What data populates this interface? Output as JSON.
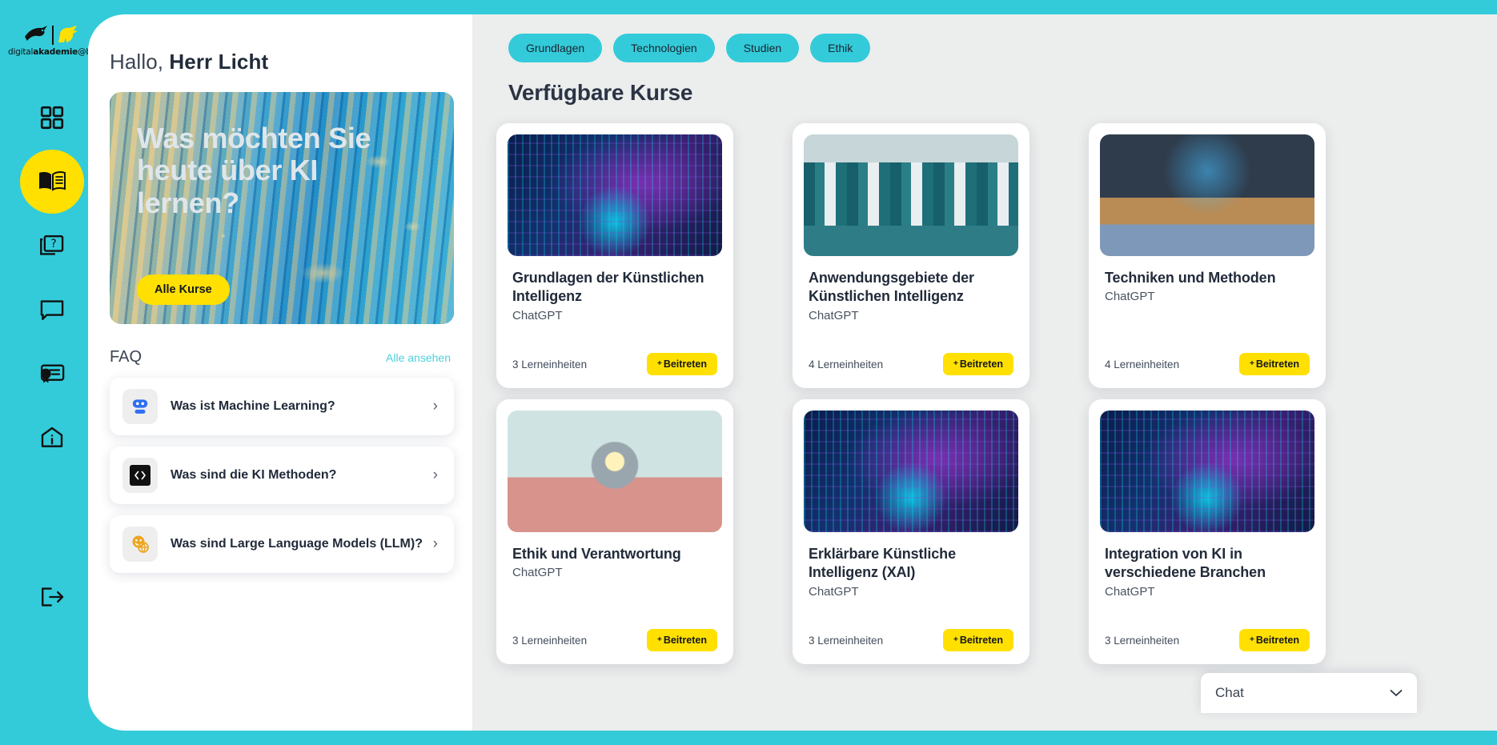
{
  "brand": {
    "wordmark_light": "digital",
    "wordmark_bold": "akademie",
    "wordmark_tail": "@bw"
  },
  "sidebar": {
    "items": [
      {
        "icon": "grid-icon",
        "label": "Dashboard",
        "active": false
      },
      {
        "icon": "book-icon",
        "label": "Kurse",
        "active": true
      },
      {
        "icon": "quiz-icon",
        "label": "Quiz",
        "active": false
      },
      {
        "icon": "chat-bubble-icon",
        "label": "Chat",
        "active": false
      },
      {
        "icon": "certificate-icon",
        "label": "Zertifikate",
        "active": false
      },
      {
        "icon": "info-icon",
        "label": "Info",
        "active": false
      }
    ],
    "logout": {
      "icon": "logout-icon",
      "label": "Abmelden"
    }
  },
  "greeting": {
    "prefix": "Hallo,",
    "name": "Herr Licht"
  },
  "hero": {
    "title": "Was möchten Sie heute über KI lernen?",
    "button": "Alle Kurse"
  },
  "faq": {
    "title": "FAQ",
    "see_all": "Alle ansehen",
    "items": [
      {
        "icon": "robot-icon",
        "question": "Was ist Machine Learning?",
        "chevron": "›"
      },
      {
        "icon": "code-brackets-icon",
        "question": "Was sind die KI Methoden?",
        "chevron": "›"
      },
      {
        "icon": "smiley-globe-icon",
        "question": "Was sind Large Language Models (LLM)?",
        "chevron": "›"
      }
    ]
  },
  "filters": [
    {
      "label": "Grundlagen"
    },
    {
      "label": "Technologien"
    },
    {
      "label": "Studien"
    },
    {
      "label": "Ethik"
    }
  ],
  "courses": {
    "heading": "Verfügbare Kurse",
    "items": [
      {
        "title": "Grundlagen der Künstlichen Intelligenz",
        "author": "ChatGPT",
        "units": "3 Lerneinheiten",
        "join": "Beitreten",
        "plus": "+",
        "thumb": "circuit-brain-image"
      },
      {
        "title": "Anwendungsgebiete der Künstlichen Intelligenz",
        "author": "ChatGPT",
        "units": "4 Lerneinheiten",
        "join": "Beitreten",
        "plus": "+",
        "thumb": "medical-team-image"
      },
      {
        "title": "Techniken und Methoden",
        "author": "ChatGPT",
        "units": "4 Lerneinheiten",
        "join": "Beitreten",
        "plus": "+",
        "thumb": "meeting-room-image"
      },
      {
        "title": "Ethik und Verantwortung",
        "author": "ChatGPT",
        "units": "3 Lerneinheiten",
        "join": "Beitreten",
        "plus": "+",
        "thumb": "robot-heart-image"
      },
      {
        "title": "Erklärbare Künstliche Intelligenz (XAI)",
        "author": "ChatGPT",
        "units": "3 Lerneinheiten",
        "join": "Beitreten",
        "plus": "+",
        "thumb": "circuit-brain-image"
      },
      {
        "title": "Integration von KI in verschiedene Branchen",
        "author": "ChatGPT",
        "units": "3 Lerneinheiten",
        "join": "Beitreten",
        "plus": "+",
        "thumb": "circuit-brain-image"
      }
    ]
  },
  "chat_dock": {
    "label": "Chat",
    "chevron": "⌄"
  },
  "colors": {
    "brand_cyan": "#33cbd9",
    "accent_yellow": "#ffe000",
    "panel_grey": "#eceded",
    "text_dark": "#222b3a",
    "link_cyan": "#4cd0de"
  }
}
